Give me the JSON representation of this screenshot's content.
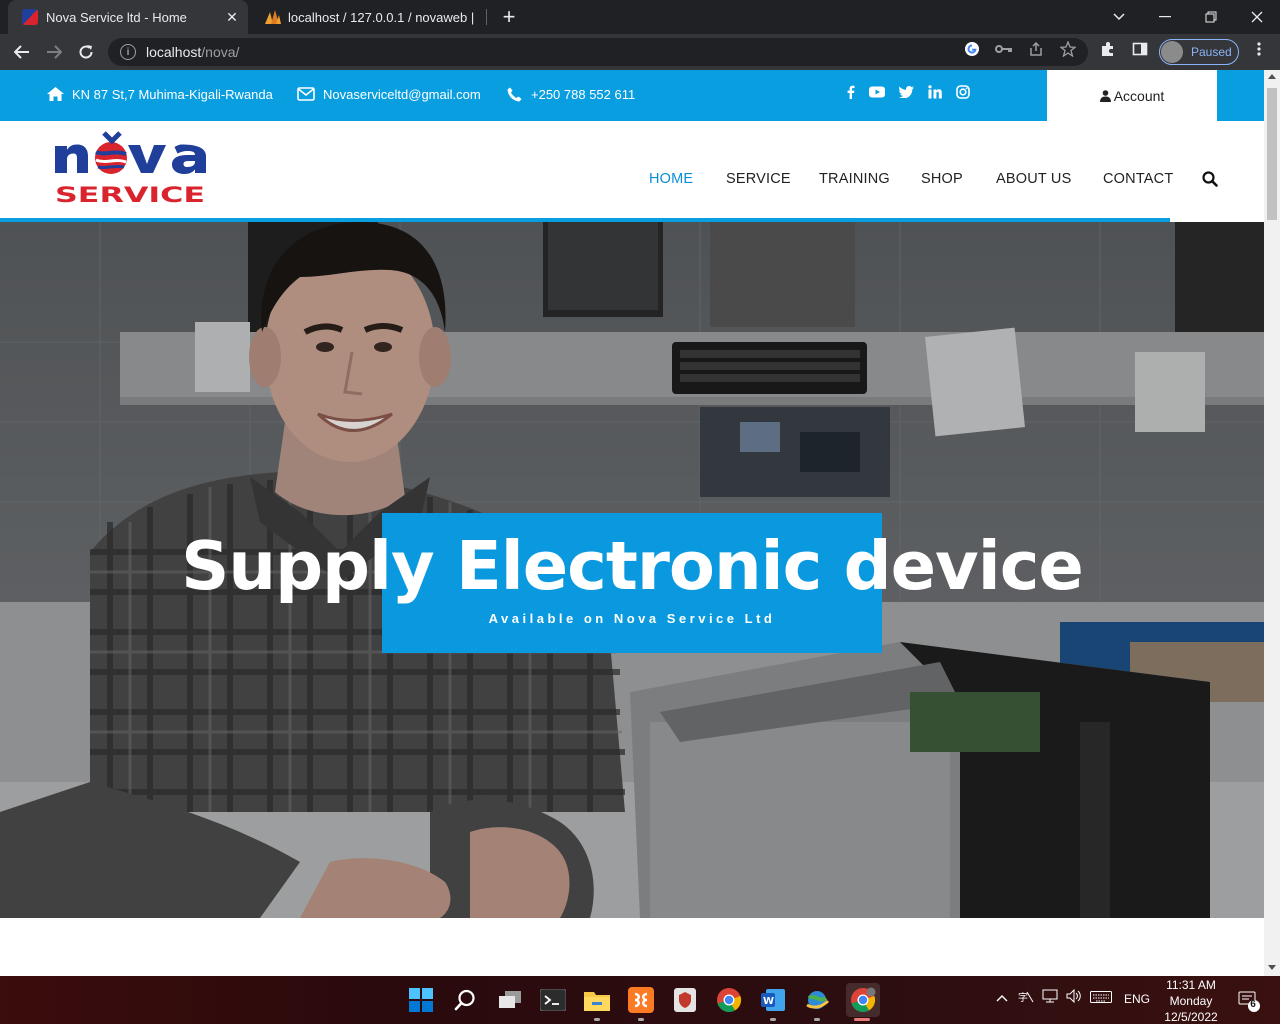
{
  "browser": {
    "tabs": [
      {
        "title": "Nova Service ltd - Home",
        "active": true
      },
      {
        "title": "localhost / 127.0.0.1 / novaweb |",
        "active": false
      }
    ],
    "new_tab": "+",
    "url_host": "localhost",
    "url_path": "/nova/",
    "profile_label": "Paused"
  },
  "topbar": {
    "address": "KN 87 St,7 Muhima-Kigali-Rwanda",
    "email": "Novaserviceltd@gmail.com",
    "phone": "+250 788 552 611",
    "social_icons": [
      "facebook-icon",
      "youtube-icon",
      "twitter-icon",
      "linkedin-icon",
      "instagram-icon"
    ],
    "account_label": "Account"
  },
  "nav": {
    "items": [
      "HOME",
      "SERVICE",
      "TRAINING",
      "SHOP",
      "ABOUT US",
      "CONTACT"
    ],
    "active": "HOME"
  },
  "hero": {
    "title": "Supply Electronic device",
    "subtitle": "Available on Nova Service Ltd"
  },
  "taskbar": {
    "lang": "ENG",
    "time": "11:31 AM",
    "day": "Monday",
    "date": "12/5/2022",
    "notification_count": "6"
  },
  "colors": {
    "brand_blue": "#099ee0",
    "nav_active": "#0a8fd6",
    "logo_blue": "#1f3f9b",
    "logo_red": "#d9232d"
  }
}
